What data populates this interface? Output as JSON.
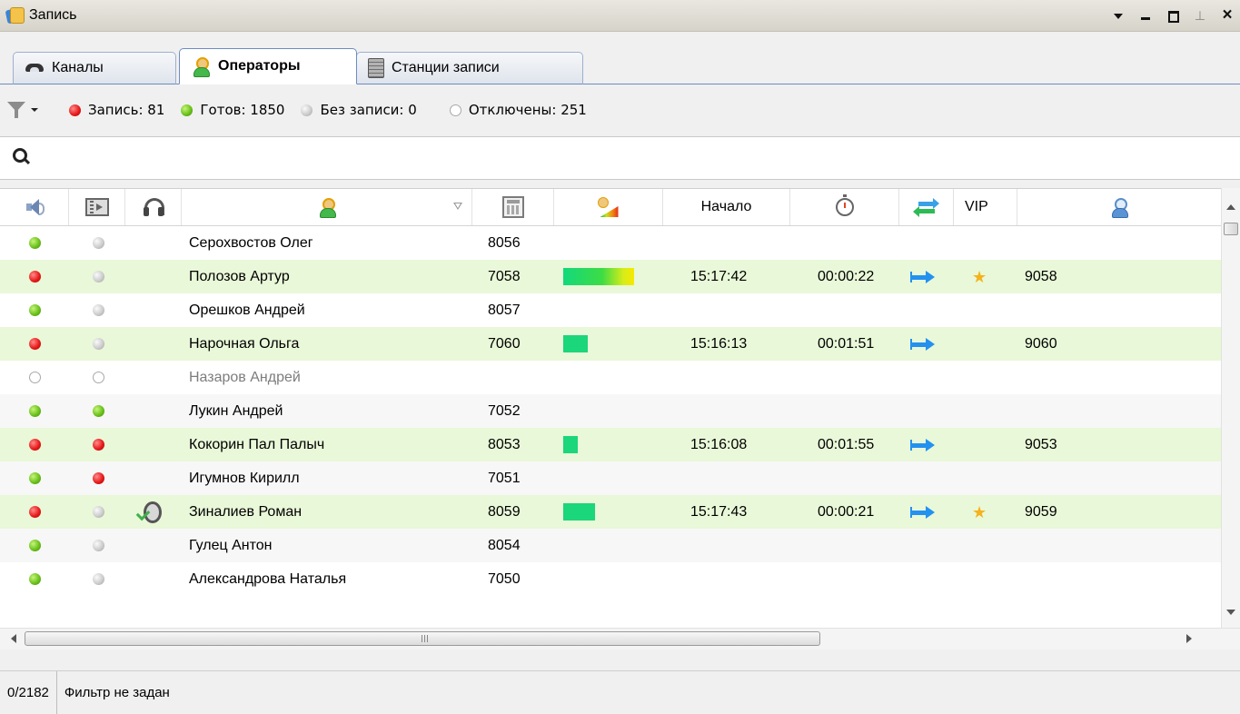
{
  "window": {
    "title": "Запись",
    "controls": [
      "dropdown-icon",
      "minimize-icon",
      "maximize-icon",
      "pin-icon",
      "close-icon"
    ]
  },
  "tabs": [
    {
      "label": "Каналы",
      "icon": "phone-icon",
      "active": false
    },
    {
      "label": "Операторы",
      "icon": "operator-icon",
      "active": true
    },
    {
      "label": "Станции записи",
      "icon": "server-icon",
      "active": false
    }
  ],
  "toolbar": {
    "recording": "Запись: 81",
    "ready": "Готов: 1850",
    "no_recording": "Без записи: 0",
    "disabled": "Отключены: 251"
  },
  "search": {
    "value": "",
    "placeholder": ""
  },
  "grid": {
    "headers": {
      "sound": "speaker-icon",
      "video": "film-icon",
      "listen": "headphones-icon",
      "operator": "operator-icon",
      "number": "calculator-icon",
      "level": "level-icon",
      "start": "Начало",
      "duration": "stopwatch-icon",
      "direction": "transfer-icon",
      "vip": "VIP",
      "extension": "operator-blue-icon"
    },
    "rows": [
      {
        "sound": "green",
        "video": "gray",
        "listen": "",
        "name": "Серохвостов Олег",
        "number": "8056",
        "level": 0,
        "start": "",
        "duration": "",
        "direction": "",
        "vip": false,
        "ext": ""
      },
      {
        "sound": "red",
        "video": "gray",
        "listen": "",
        "name": "Полозов Артур",
        "number": "7058",
        "level": 1,
        "start": "15:17:42",
        "duration": "00:00:22",
        "direction": "outgoing",
        "vip": true,
        "ext": "9058"
      },
      {
        "sound": "green",
        "video": "gray",
        "listen": "",
        "name": "Орешков Андрей",
        "number": "8057",
        "level": 0,
        "start": "",
        "duration": "",
        "direction": "",
        "vip": false,
        "ext": ""
      },
      {
        "sound": "red",
        "video": "gray",
        "listen": "",
        "name": "Нарочная Ольга",
        "number": "7060",
        "level": 0.35,
        "start": "15:16:13",
        "duration": "00:01:51",
        "direction": "outgoing",
        "vip": false,
        "ext": "9060"
      },
      {
        "sound": "off",
        "video": "off",
        "listen": "",
        "name": "Назаров Андрей",
        "number": "",
        "level": 0,
        "start": "",
        "duration": "",
        "direction": "",
        "vip": false,
        "ext": ""
      },
      {
        "sound": "green",
        "video": "green",
        "listen": "",
        "name": "Лукин Андрей",
        "number": "7052",
        "level": 0,
        "start": "",
        "duration": "",
        "direction": "",
        "vip": false,
        "ext": ""
      },
      {
        "sound": "red",
        "video": "red",
        "listen": "",
        "name": "Кокорин Пал Палыч",
        "number": "8053",
        "level": 0.2,
        "start": "15:16:08",
        "duration": "00:01:55",
        "direction": "outgoing",
        "vip": false,
        "ext": "9053"
      },
      {
        "sound": "green",
        "video": "red",
        "listen": "",
        "name": "Игумнов Кирилл",
        "number": "7051",
        "level": 0,
        "start": "",
        "duration": "",
        "direction": "",
        "vip": false,
        "ext": ""
      },
      {
        "sound": "red",
        "video": "gray",
        "listen": "ear-check-icon",
        "name": "Зиналиев Роман",
        "number": "8059",
        "level": 0.45,
        "start": "15:17:43",
        "duration": "00:00:21",
        "direction": "outgoing",
        "vip": true,
        "ext": "9059"
      },
      {
        "sound": "green",
        "video": "gray",
        "listen": "",
        "name": "Гулец Антон",
        "number": "8054",
        "level": 0,
        "start": "",
        "duration": "",
        "direction": "",
        "vip": false,
        "ext": ""
      },
      {
        "sound": "green",
        "video": "gray",
        "listen": "",
        "name": "Александрова Наталья",
        "number": "7050",
        "level": 0,
        "start": "",
        "duration": "",
        "direction": "",
        "vip": false,
        "ext": ""
      }
    ]
  },
  "statusbar": {
    "count": "0/2182",
    "filter": "Фильтр не задан"
  },
  "colors": {
    "active_row": "#e9f8d8",
    "level_bar": "#1bd67a",
    "direction_arrow": "#2391f0",
    "vip_star": "#f5b21b"
  }
}
